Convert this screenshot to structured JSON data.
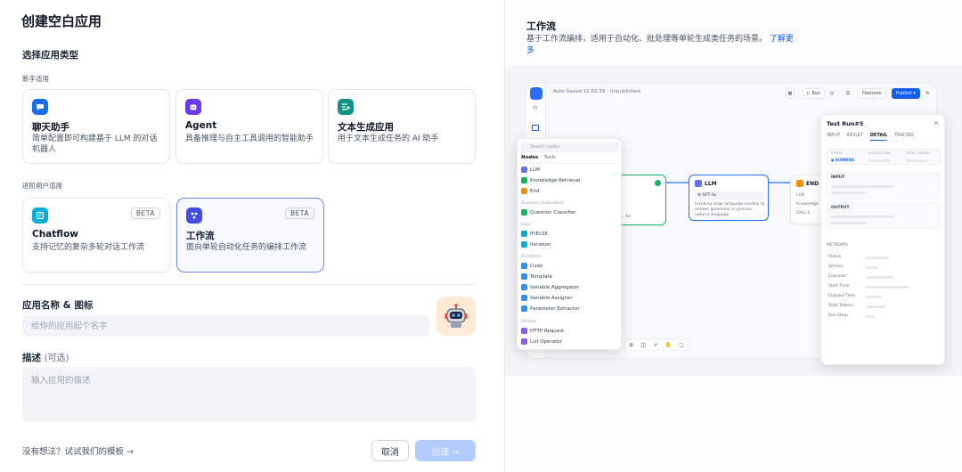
{
  "page_title": "创建空白应用",
  "section_title": "选择应用类型",
  "groups": {
    "beginner": "新手适用",
    "advanced": "进阶用户适用"
  },
  "cards": [
    {
      "name": "聊天助手",
      "desc": "简单配置即可构建基于 LLM 的对话机器人",
      "color": "#1570ef",
      "icon": "chat-bubble-icon"
    },
    {
      "name": "Agent",
      "desc": "具备推理与自主工具调用的智能助手",
      "color": "#6938ef",
      "icon": "robot-icon"
    },
    {
      "name": "文本生成应用",
      "desc": "用于文本生成任务的 AI 助手",
      "color": "#0e9384",
      "icon": "text-generate-icon"
    },
    {
      "name": "Chatflow",
      "desc": "支持记忆的复杂多轮对话工作流",
      "badge": "BETA",
      "color": "#06aed4",
      "icon": "chatflow-icon"
    },
    {
      "name": "工作流",
      "desc": "面向单轮自动化任务的编排工作流",
      "badge": "BETA",
      "color": "#444ce7",
      "icon": "workflow-icon",
      "selected": true
    }
  ],
  "form": {
    "name_label": "应用名称 & 图标",
    "name_placeholder": "给你的应用起个名字",
    "desc_label": "描述",
    "desc_optional": "(可选)",
    "desc_placeholder": "输入应用的描述"
  },
  "footer": {
    "template_link": "没有想法？试试我们的模板 →",
    "cancel": "取消",
    "create": "创建 →"
  },
  "preview": {
    "title": "工作流",
    "desc": "基于工作流编排，适用于自动化、批处理等单轮生成类任务的场景。",
    "more": "了解更多",
    "topbar": "Auto-Saved 11:02:39 · Unpublished",
    "run": "▷ Run",
    "features": "Features",
    "publish": "Publish ▾",
    "llm_node": "LLM",
    "llm_model": "GPT-4o",
    "llm_desc": "Invoking large language models to answer questions or process natural language",
    "end_node": "END",
    "end_outputs": [
      "LLM",
      "Knowledge",
      "DALL-E"
    ],
    "search_placeholder": "Search nodes",
    "tab_nodes": "Nodes",
    "tab_tools": "Tools",
    "node_items": [
      {
        "cat": "",
        "items": [
          {
            "name": "LLM",
            "color": "#6172f3"
          },
          {
            "name": "Knowledge Retrieval",
            "color": "#16b364"
          },
          {
            "name": "End",
            "color": "#f79009"
          }
        ]
      },
      {
        "cat": "Question Understand",
        "items": [
          {
            "name": "Question Classifier",
            "color": "#16b364"
          }
        ]
      },
      {
        "cat": "Logic",
        "items": [
          {
            "name": "IF/ELSE",
            "color": "#06aed4"
          },
          {
            "name": "Iteration",
            "color": "#06aed4"
          }
        ]
      },
      {
        "cat": "Transform",
        "items": [
          {
            "name": "Code",
            "color": "#2e90fa"
          },
          {
            "name": "Template",
            "color": "#2e90fa"
          },
          {
            "name": "Variable Aggregator",
            "color": "#2e90fa"
          },
          {
            "name": "Variable Assigner",
            "color": "#2e90fa"
          },
          {
            "name": "Parameter Extractor",
            "color": "#2e90fa"
          }
        ]
      },
      {
        "cat": "Utilities",
        "items": [
          {
            "name": "HTTP Request",
            "color": "#875bf7"
          },
          {
            "name": "List Operator",
            "color": "#875bf7"
          }
        ]
      }
    ],
    "testrun": {
      "title": "Test Run#5",
      "close": "×",
      "tabs": [
        "INPUT",
        "RESULT",
        "DETAIL",
        "TRACING"
      ],
      "active_tab": "DETAIL",
      "status_cols": [
        "STATUS",
        "ELAPSED TIME",
        "TOTAL TOKENS"
      ],
      "status_value": "● RUNNING",
      "input_label": "INPUT",
      "output_label": "OUTPUT",
      "metadata_label": "METADATA",
      "meta_rows": [
        "Status",
        "Version",
        "Executor",
        "Start Time",
        "Elapsed Time",
        "Total Tokens",
        "Run Steps"
      ]
    }
  }
}
